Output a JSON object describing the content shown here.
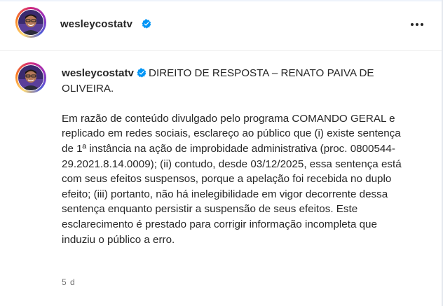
{
  "header": {
    "username": "wesleycostatv",
    "verified_icon": "verified-badge-icon",
    "more_icon": "more-options-icon"
  },
  "caption": {
    "username": "wesleycostatv",
    "title": "DIREITO DE RESPOSTA – RENATO PAIVA DE OLIVEIRA.",
    "body": "Em razão de conteúdo divulgado pelo programa COMANDO GERAL e replicado em redes sociais, esclareço ao público que (i) existe sentença de 1ª instância na ação de improbidade administrativa (proc. 0800544-29.2021.8.14.0009); (ii) contudo, desde 03/12/2025, essa sentença está com seus efeitos suspensos, porque a apelação foi recebida no duplo efeito; (iii) portanto, não há inelegibilidade em vigor decorrente dessa sentença enquanto persistir a suspensão de seus efeitos. Este esclarecimento é prestado para corrigir informação incompleta que induziu o público a erro.",
    "time": "5 d"
  },
  "colors": {
    "verified_blue": "#0095f6",
    "text": "#262626",
    "muted": "#737373"
  }
}
